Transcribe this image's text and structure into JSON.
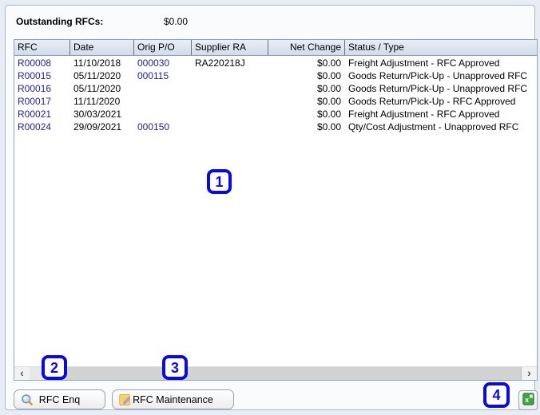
{
  "summary": {
    "label": "Outstanding RFCs:",
    "value": "$0.00"
  },
  "table": {
    "columns": [
      {
        "label": "RFC"
      },
      {
        "label": "Date"
      },
      {
        "label": "Orig P/O"
      },
      {
        "label": "Supplier RA"
      },
      {
        "label": "Net Change"
      },
      {
        "label": "Status / Type"
      }
    ],
    "rows": [
      {
        "rfc": "R00008",
        "date": "11/10/2018",
        "orig_po": "000030",
        "supplier_ra": "RA220218J",
        "net_change": "$0.00",
        "status_type": "Freight Adjustment - RFC Approved"
      },
      {
        "rfc": "R00015",
        "date": "05/11/2020",
        "orig_po": "000115",
        "supplier_ra": "",
        "net_change": "$0.00",
        "status_type": "Goods Return/Pick-Up - Unapproved RFC"
      },
      {
        "rfc": "R00016",
        "date": "05/11/2020",
        "orig_po": "",
        "supplier_ra": "",
        "net_change": "$0.00",
        "status_type": "Goods Return/Pick-Up - Unapproved RFC"
      },
      {
        "rfc": "R00017",
        "date": "11/11/2020",
        "orig_po": "",
        "supplier_ra": "",
        "net_change": "$0.00",
        "status_type": "Goods Return/Pick-Up - RFC Approved"
      },
      {
        "rfc": "R00021",
        "date": "30/03/2021",
        "orig_po": "",
        "supplier_ra": "",
        "net_change": "$0.00",
        "status_type": "Freight Adjustment - RFC Approved"
      },
      {
        "rfc": "R00024",
        "date": "29/09/2021",
        "orig_po": "000150",
        "supplier_ra": "",
        "net_change": "$0.00",
        "status_type": "Qty/Cost Adjustment - Unapproved RFC"
      }
    ]
  },
  "scrollbar": {
    "left_arrow": "‹",
    "right_arrow": "›"
  },
  "buttons": {
    "rfc_enq": "RFC Enq",
    "rfc_maintenance": "RFC Maintenance",
    "export_excel_icon": "excel-export"
  },
  "annotations": [
    {
      "label": "1"
    },
    {
      "label": "2"
    },
    {
      "label": "3"
    },
    {
      "label": "4"
    }
  ],
  "colors": {
    "annotation_blue": "#0a0ae0",
    "link_navy": "#21219c",
    "header_bg": "#dce4ef",
    "excel_green": "#42a045",
    "panel_border": "#aab8cc"
  }
}
